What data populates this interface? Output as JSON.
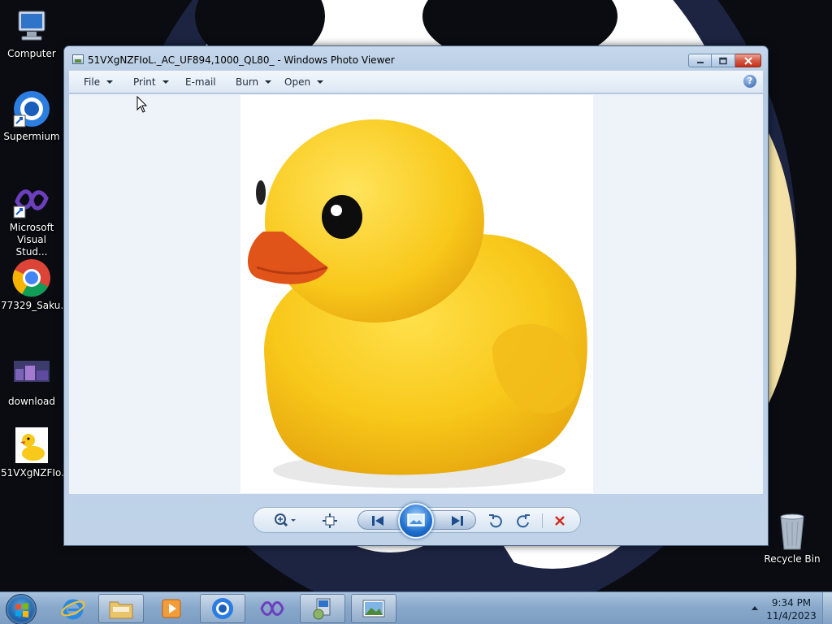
{
  "desktop": {
    "icons": [
      {
        "label": "Computer"
      },
      {
        "label": "Supermium"
      },
      {
        "label": "Microsoft Visual Stud..."
      },
      {
        "label": "77329_Saku..."
      },
      {
        "label": "download"
      },
      {
        "label": "51VXgNZFIo..."
      },
      {
        "label": "Recycle Bin"
      }
    ]
  },
  "window": {
    "title": "51VXgNZFIoL._AC_UF894,1000_QL80_ - Windows Photo Viewer",
    "menu": {
      "file": "File",
      "print": "Print",
      "email": "E-mail",
      "burn": "Burn",
      "open": "Open",
      "help": "?"
    }
  },
  "taskbar": {
    "time": "9:34 PM",
    "date": "11/4/2023"
  },
  "colors": {
    "duck_body": "#f8c81a",
    "duck_beak": "#e0541a",
    "accent": "#1f6fcf",
    "delete_red": "#d42a1c"
  }
}
